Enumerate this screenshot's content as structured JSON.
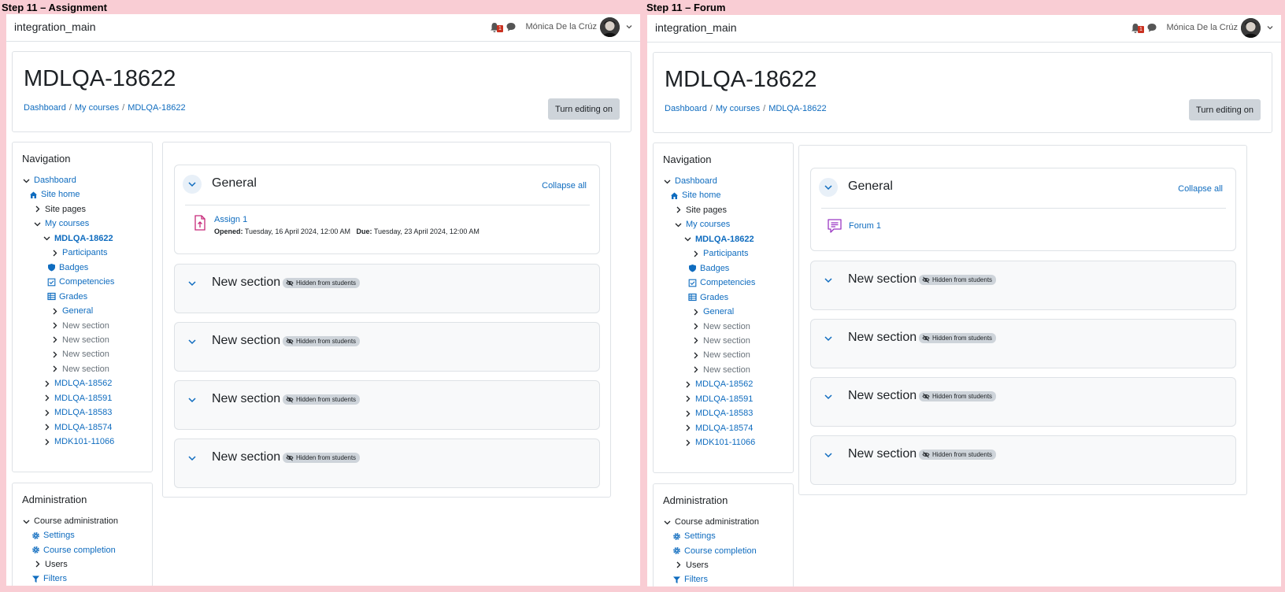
{
  "colors": {
    "link": "#0f6cbf",
    "assign_icon": "#c7297a",
    "forum_icon": "#9b38c4",
    "background": "#f9cdd4"
  },
  "panels": {
    "left": {
      "label": "Step 11 – Assignment",
      "site_name": "integration_main",
      "notification_count": "1",
      "user_name": "Mónica De la Crúz",
      "course_title": "MDLQA-18622",
      "breadcrumb": [
        "Dashboard",
        "My courses",
        "MDLQA-18622"
      ],
      "edit_button": "Turn editing on",
      "navigation": {
        "title": "Navigation",
        "items": [
          {
            "label": "Dashboard",
            "icon": "chevron-down-icon"
          },
          {
            "label": "Site home",
            "icon": "home-icon"
          },
          {
            "label": "Site pages",
            "icon": "chevron-right-icon"
          },
          {
            "label": "My courses",
            "icon": "chevron-down-icon"
          },
          {
            "label": "MDLQA-18622",
            "icon": "chevron-down-icon"
          },
          {
            "label": "Participants",
            "icon": "chevron-right-icon"
          },
          {
            "label": "Badges",
            "icon": "shield-icon"
          },
          {
            "label": "Competencies",
            "icon": "checkbox-icon"
          },
          {
            "label": "Grades",
            "icon": "table-icon"
          },
          {
            "label": "General",
            "icon": "chevron-right-icon"
          },
          {
            "label": "New section",
            "icon": "chevron-right-icon"
          },
          {
            "label": "New section",
            "icon": "chevron-right-icon"
          },
          {
            "label": "New section",
            "icon": "chevron-right-icon"
          },
          {
            "label": "New section",
            "icon": "chevron-right-icon"
          },
          {
            "label": "MDLQA-18562",
            "icon": "chevron-right-icon"
          },
          {
            "label": "MDLQA-18591",
            "icon": "chevron-right-icon"
          },
          {
            "label": "MDLQA-18583",
            "icon": "chevron-right-icon"
          },
          {
            "label": "MDLQA-18574",
            "icon": "chevron-right-icon"
          },
          {
            "label": "MDK101-11066",
            "icon": "chevron-right-icon"
          }
        ]
      },
      "administration": {
        "title": "Administration",
        "items": [
          {
            "label": "Course administration",
            "icon": "chevron-down-icon"
          },
          {
            "label": "Settings",
            "icon": "gear-icon"
          },
          {
            "label": "Course completion",
            "icon": "gear-icon"
          },
          {
            "label": "Users",
            "icon": "chevron-right-icon"
          },
          {
            "label": "Filters",
            "icon": "filter-icon"
          }
        ]
      },
      "general": {
        "title": "General",
        "collapse_all": "Collapse all",
        "activity": {
          "name": "Assign 1",
          "icon": "assignment-icon",
          "opened_label": "Opened:",
          "opened_value": "Tuesday, 16 April 2024, 12:00 AM",
          "due_label": "Due:",
          "due_value": "Tuesday, 23 April 2024, 12:00 AM"
        }
      },
      "sections": [
        {
          "title": "New section",
          "badge": "Hidden from students"
        },
        {
          "title": "New section",
          "badge": "Hidden from students"
        },
        {
          "title": "New section",
          "badge": "Hidden from students"
        },
        {
          "title": "New section",
          "badge": "Hidden from students"
        }
      ]
    },
    "right": {
      "label": "Step 11 – Forum",
      "site_name": "integration_main",
      "notification_count": "1",
      "user_name": "Mónica De la Crúz",
      "course_title": "MDLQA-18622",
      "breadcrumb": [
        "Dashboard",
        "My courses",
        "MDLQA-18622"
      ],
      "edit_button": "Turn editing on",
      "navigation": {
        "title": "Navigation",
        "items": [
          {
            "label": "Dashboard",
            "icon": "chevron-down-icon"
          },
          {
            "label": "Site home",
            "icon": "home-icon"
          },
          {
            "label": "Site pages",
            "icon": "chevron-right-icon"
          },
          {
            "label": "My courses",
            "icon": "chevron-down-icon"
          },
          {
            "label": "MDLQA-18622",
            "icon": "chevron-down-icon"
          },
          {
            "label": "Participants",
            "icon": "chevron-right-icon"
          },
          {
            "label": "Badges",
            "icon": "shield-icon"
          },
          {
            "label": "Competencies",
            "icon": "checkbox-icon"
          },
          {
            "label": "Grades",
            "icon": "table-icon"
          },
          {
            "label": "General",
            "icon": "chevron-right-icon"
          },
          {
            "label": "New section",
            "icon": "chevron-right-icon"
          },
          {
            "label": "New section",
            "icon": "chevron-right-icon"
          },
          {
            "label": "New section",
            "icon": "chevron-right-icon"
          },
          {
            "label": "New section",
            "icon": "chevron-right-icon"
          },
          {
            "label": "MDLQA-18562",
            "icon": "chevron-right-icon"
          },
          {
            "label": "MDLQA-18591",
            "icon": "chevron-right-icon"
          },
          {
            "label": "MDLQA-18583",
            "icon": "chevron-right-icon"
          },
          {
            "label": "MDLQA-18574",
            "icon": "chevron-right-icon"
          },
          {
            "label": "MDK101-11066",
            "icon": "chevron-right-icon"
          }
        ]
      },
      "administration": {
        "title": "Administration",
        "items": [
          {
            "label": "Course administration",
            "icon": "chevron-down-icon"
          },
          {
            "label": "Settings",
            "icon": "gear-icon"
          },
          {
            "label": "Course completion",
            "icon": "gear-icon"
          },
          {
            "label": "Users",
            "icon": "chevron-right-icon"
          },
          {
            "label": "Filters",
            "icon": "filter-icon"
          }
        ]
      },
      "general": {
        "title": "General",
        "collapse_all": "Collapse all",
        "activity": {
          "name": "Forum 1",
          "icon": "forum-icon"
        }
      },
      "sections": [
        {
          "title": "New section",
          "badge": "Hidden from students"
        },
        {
          "title": "New section",
          "badge": "Hidden from students"
        },
        {
          "title": "New section",
          "badge": "Hidden from students"
        },
        {
          "title": "New section",
          "badge": "Hidden from students"
        }
      ]
    }
  }
}
